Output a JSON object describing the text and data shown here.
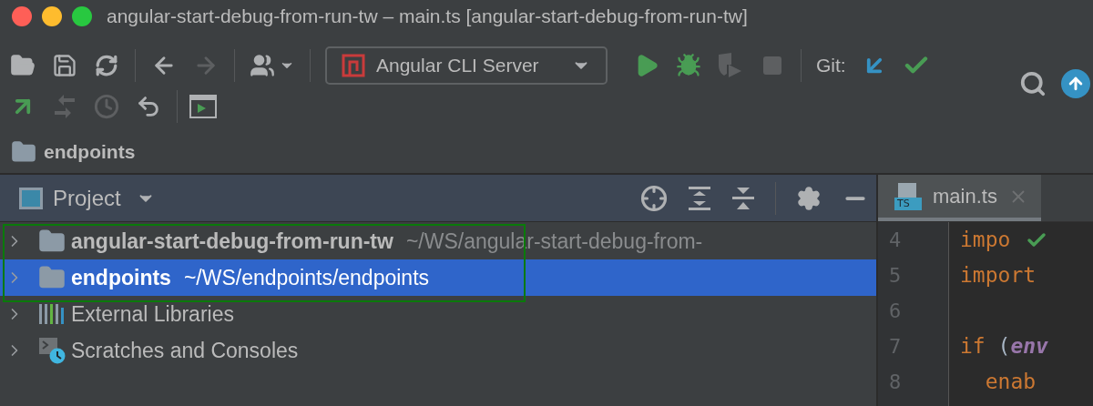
{
  "window": {
    "title": "angular-start-debug-from-run-tw – main.ts [angular-start-debug-from-run-tw]"
  },
  "toolbar": {
    "file_buttons": [
      {
        "disabled": false
      },
      {
        "disabled": false
      },
      {
        "disabled": false
      }
    ],
    "nav_buttons": [
      {
        "disabled": false
      },
      {
        "disabled": true
      }
    ],
    "run_configuration": "Angular CLI Server",
    "run_buttons": [
      {
        "disabled": false
      },
      {
        "disabled": false
      },
      {
        "disabled": true
      },
      {
        "disabled": true
      }
    ],
    "git_label": "Git:",
    "git_buttons": [
      {
        "disabled": false
      },
      {
        "disabled": false
      }
    ],
    "vcs_buttons": [
      {
        "disabled": false
      },
      {
        "disabled": true
      },
      {
        "disabled": true
      },
      {
        "disabled": false
      }
    ]
  },
  "breadcrumb": {
    "label": "endpoints"
  },
  "project_panel": {
    "title": "Project",
    "annotation_frame": true,
    "items": [
      {
        "kind": "project",
        "label": "angular-start-debug-from-run-tw",
        "path": "~/WS/angular-start-debug-from-",
        "selected": false,
        "expanded": false
      },
      {
        "kind": "project",
        "label": "endpoints",
        "path": "~/WS/endpoints/endpoints",
        "selected": true,
        "expanded": false
      },
      {
        "kind": "libraries",
        "label": "External Libraries",
        "selected": false,
        "expanded": false
      },
      {
        "kind": "scratches",
        "label": "Scratches and Consoles",
        "selected": false,
        "expanded": false
      }
    ]
  },
  "editor": {
    "tabs": [
      {
        "label": "main.ts",
        "file_badge": "TS",
        "selected": true
      }
    ],
    "lines": [
      {
        "number": "4",
        "tokens": [
          {
            "kind": "keyword",
            "text": "impo"
          }
        ]
      },
      {
        "number": "5",
        "tokens": [
          {
            "kind": "keyword",
            "text": "import"
          }
        ]
      },
      {
        "number": "6"
      },
      {
        "number": "7",
        "tokens": [
          {
            "kind": "keyword",
            "text": "if"
          },
          {
            "kind": "plain",
            "text": " ("
          },
          {
            "kind": "field",
            "text": "env"
          }
        ]
      },
      {
        "number": "8",
        "tokens": [
          {
            "kind": "keyword",
            "text": "  enab"
          }
        ]
      }
    ]
  }
}
